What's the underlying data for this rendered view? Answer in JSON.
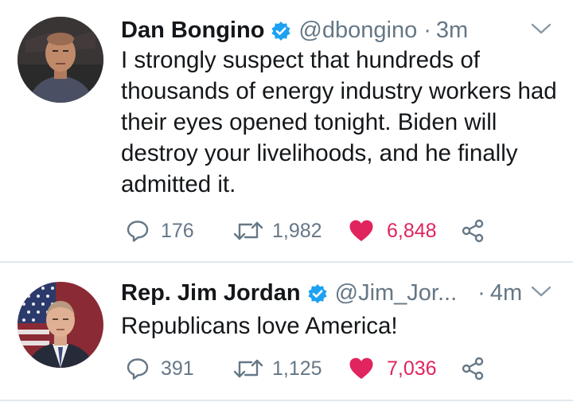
{
  "tweets": [
    {
      "author_name": "Dan Bongino",
      "handle": "@dbongino",
      "time": "3m",
      "text": "I strongly suspect that hundreds of thousands of energy industry workers had their eyes opened tonight. Biden will destroy your livelihoods, and he finally admitted it.",
      "replies": "176",
      "retweets": "1,982",
      "likes": "6,848",
      "liked": true,
      "verified": true,
      "avatar_icon": "man-portrait-avatar"
    },
    {
      "author_name": "Rep. Jim Jordan",
      "handle": "@Jim_Jor...",
      "time": "4m",
      "text": "Republicans love America!",
      "replies": "391",
      "retweets": "1,125",
      "likes": "7,036",
      "liked": true,
      "verified": true,
      "avatar_icon": "man-with-flag-avatar"
    }
  ],
  "separator": "·",
  "icons": {
    "reply": "speech-bubble-icon",
    "retweet": "retweet-arrows-icon",
    "like": "heart-icon",
    "share": "share-nodes-icon",
    "menu": "chevron-down-icon",
    "verified": "verified-badge-icon"
  },
  "colors": {
    "text": "#14171a",
    "secondary": "#657786",
    "like": "#e0245e",
    "verified": "#1da1f2",
    "divider": "#e1e8ed"
  }
}
